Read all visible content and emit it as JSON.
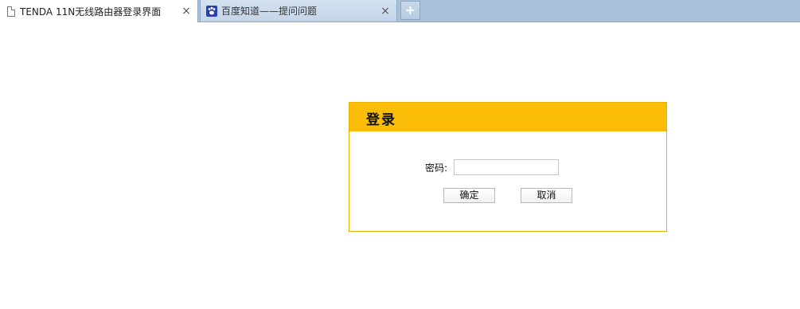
{
  "browser": {
    "tabs": [
      {
        "title": "TENDA 11N无线路由器登录界面",
        "icon": "page-icon",
        "active": true
      },
      {
        "title": "百度知道——提问问题",
        "icon": "baidu-paw-icon",
        "active": false
      }
    ],
    "close_glyph": "×",
    "new_tab_glyph": "+"
  },
  "login": {
    "title": "登录",
    "password_label": "密码:",
    "password_value": "",
    "confirm_label": "确定",
    "cancel_label": "取消"
  },
  "colors": {
    "header": "#fbbd08",
    "panel_border": "#e8b200",
    "tabstrip": "#a9c2dc"
  }
}
